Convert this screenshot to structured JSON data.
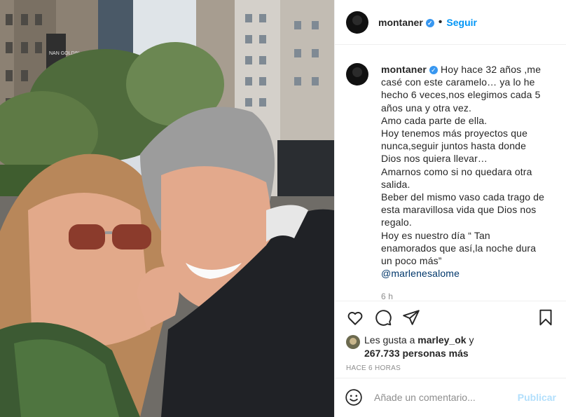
{
  "post": {
    "username": "montaner",
    "follow_label": "Seguir",
    "dot": "•",
    "verified_glyph": "✓",
    "caption_lines": [
      "Hoy hace 32 años ,me",
      "casé con este caramelo… ya lo he",
      "hecho 6 veces,nos elegimos cada 5",
      "años una y otra vez.",
      "Amo cada parte de ella.",
      "Hoy tenemos más proyectos que",
      "nunca,seguir juntos hasta donde",
      "Dios nos quiera llevar…",
      "Amarnos como si no quedara otra",
      "salida.",
      "Beber del mismo vaso cada trago de",
      "esta maravillosa vida que Dios nos",
      "regalo.",
      "Hoy es nuestro día “ Tan",
      "enamorados que así,la noche dura",
      "un poco más”"
    ],
    "mention": "@marlenesalome",
    "time_small": "6 h",
    "likes_prefix": "Les gusta a",
    "likes_user": "marley_ok",
    "likes_and": "y",
    "likes_count": "267.733 personas más",
    "time_ago": "HACE 6 HORAS",
    "comment_placeholder": "Añade un comentario...",
    "publish_label": "Publicar",
    "photo_sign_text": "NAN GOLDIN"
  },
  "icons": {
    "like": "heart-icon",
    "comment": "comment-icon",
    "share": "share-icon",
    "save": "bookmark-icon",
    "emoji": "emoji-icon"
  },
  "colors": {
    "link_blue": "#0095f6",
    "verified_blue": "#3897f0",
    "muted": "#8e8e8e",
    "publish_disabled": "#b2dffc"
  }
}
